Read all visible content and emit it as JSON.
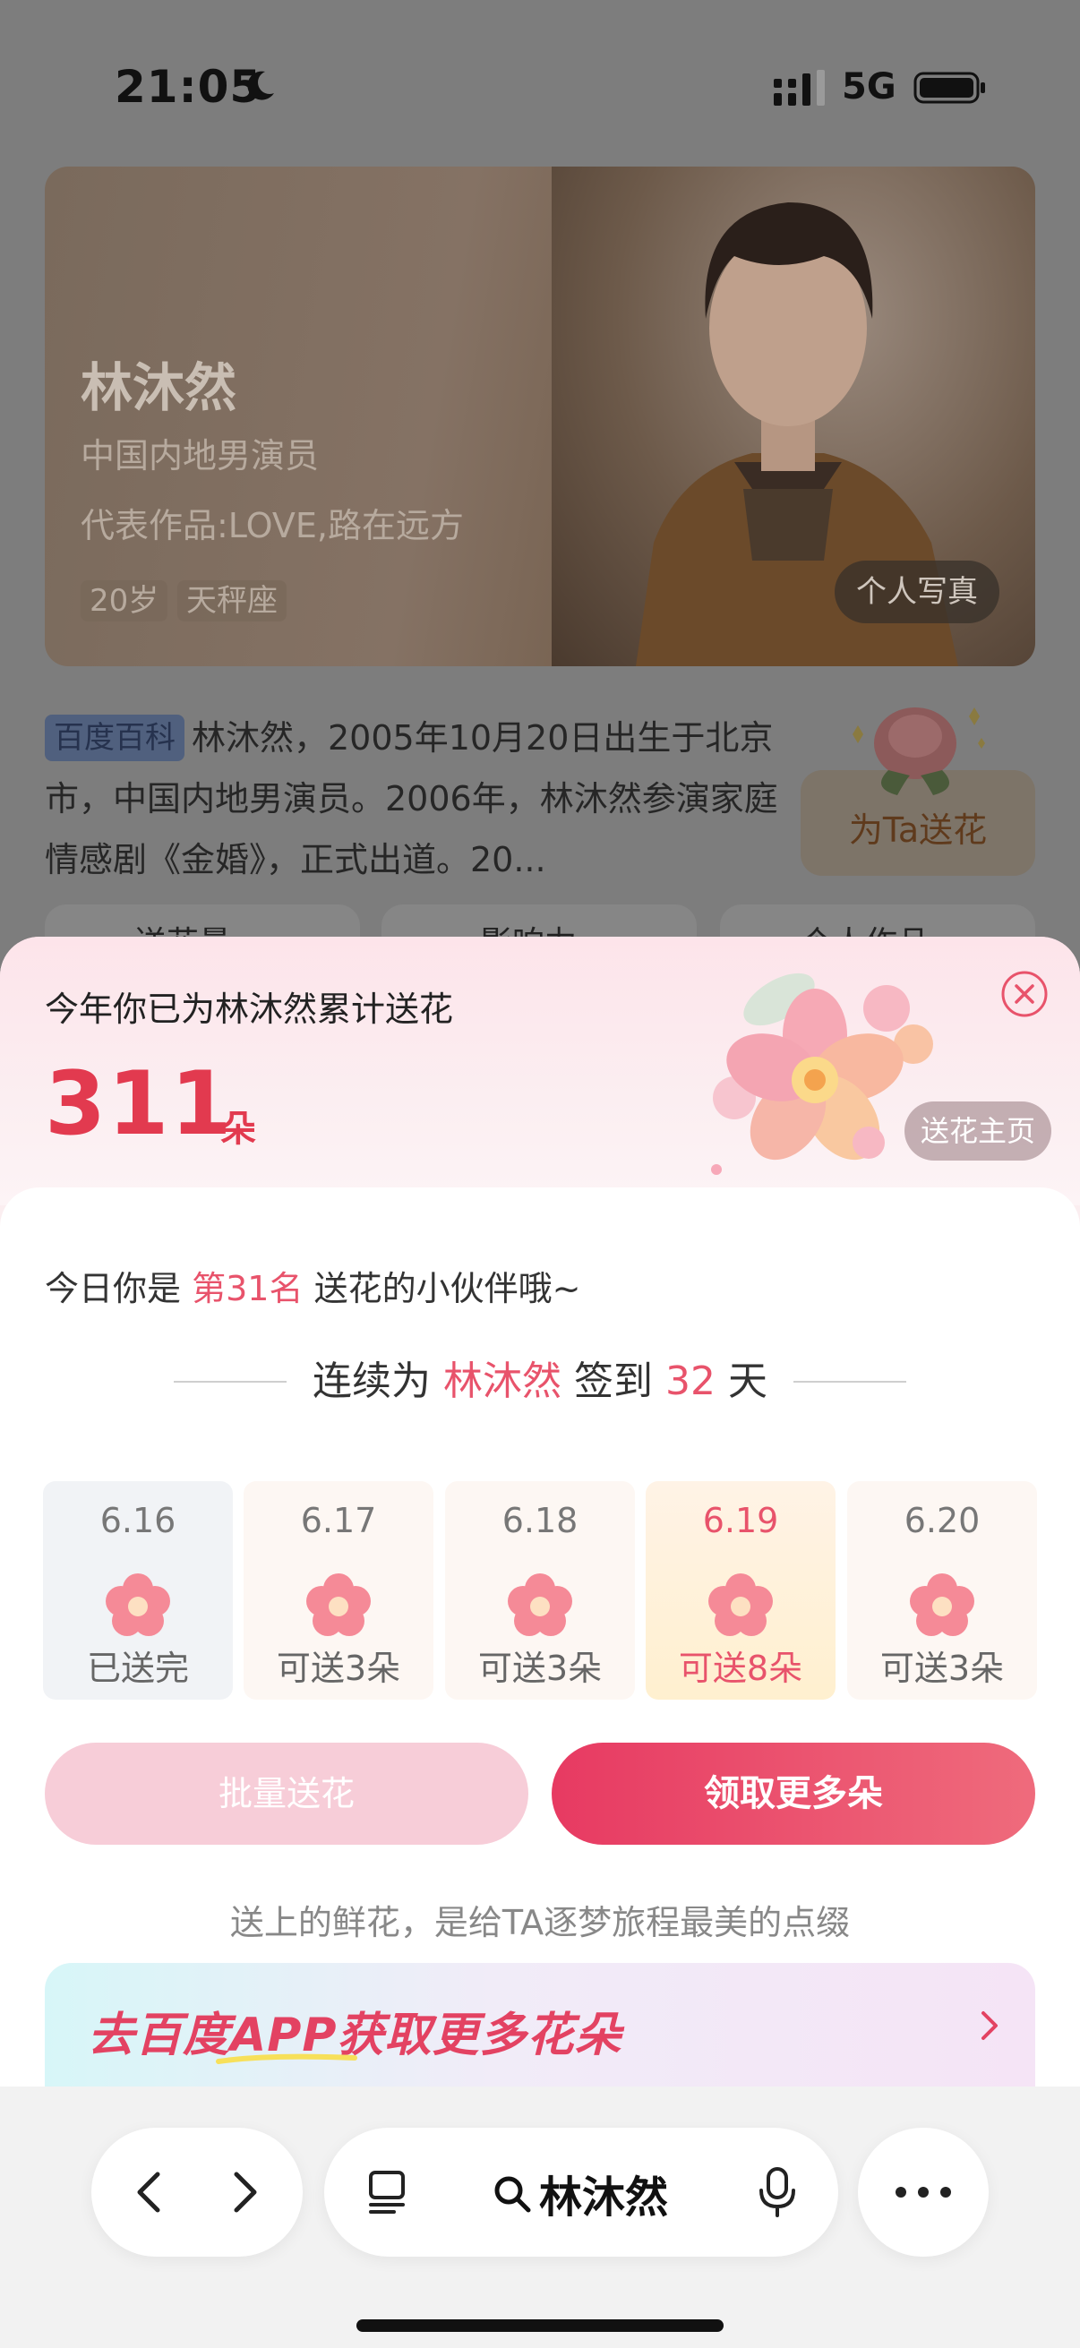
{
  "status": {
    "time": "21:05",
    "network": "5G"
  },
  "profile": {
    "name": "林沐然",
    "subtitle": "中国内地男演员",
    "works": "代表作品:LOVE,路在远方",
    "tags": [
      "20岁",
      "天秤座"
    ],
    "photo_button": "个人写真",
    "bio_badge": "百度百科",
    "bio_text": "林沐然，2005年10月20日出生于北京市，中国内地男演员。2006年，林沐然参演家庭情感剧《金婚》，正式出道。20...",
    "send_flower": "为Ta送花",
    "tabs": [
      "送花量",
      "影响力",
      "个人作品"
    ]
  },
  "sheet": {
    "title": "今年你已为林沐然累计送花",
    "count": "311",
    "count_unit": "朵",
    "home_button": "送花主页",
    "rank_prefix": "今日你是",
    "rank_value": "第31名",
    "rank_suffix": "送花的小伙伴哦~",
    "streak_prefix": "连续为",
    "streak_name": "林沐然",
    "streak_mid": "签到",
    "streak_days": "32",
    "streak_unit": "天",
    "days": [
      {
        "date": "6.16",
        "label": "已送完"
      },
      {
        "date": "6.17",
        "label": "可送3朵"
      },
      {
        "date": "6.18",
        "label": "可送3朵"
      },
      {
        "date": "6.19",
        "label": "可送8朵"
      },
      {
        "date": "6.20",
        "label": "可送3朵"
      }
    ],
    "batch_button": "批量送花",
    "more_button": "领取更多朵",
    "slogan": "送上的鲜花，是给TA逐梦旅程最美的点缀",
    "promo": "去百度APP获取更多花朵"
  },
  "toolbar": {
    "search_query": "林沐然"
  },
  "colors": {
    "accent": "#e8536b",
    "count": "#e23a4f",
    "primary_button": "#e73a62"
  }
}
